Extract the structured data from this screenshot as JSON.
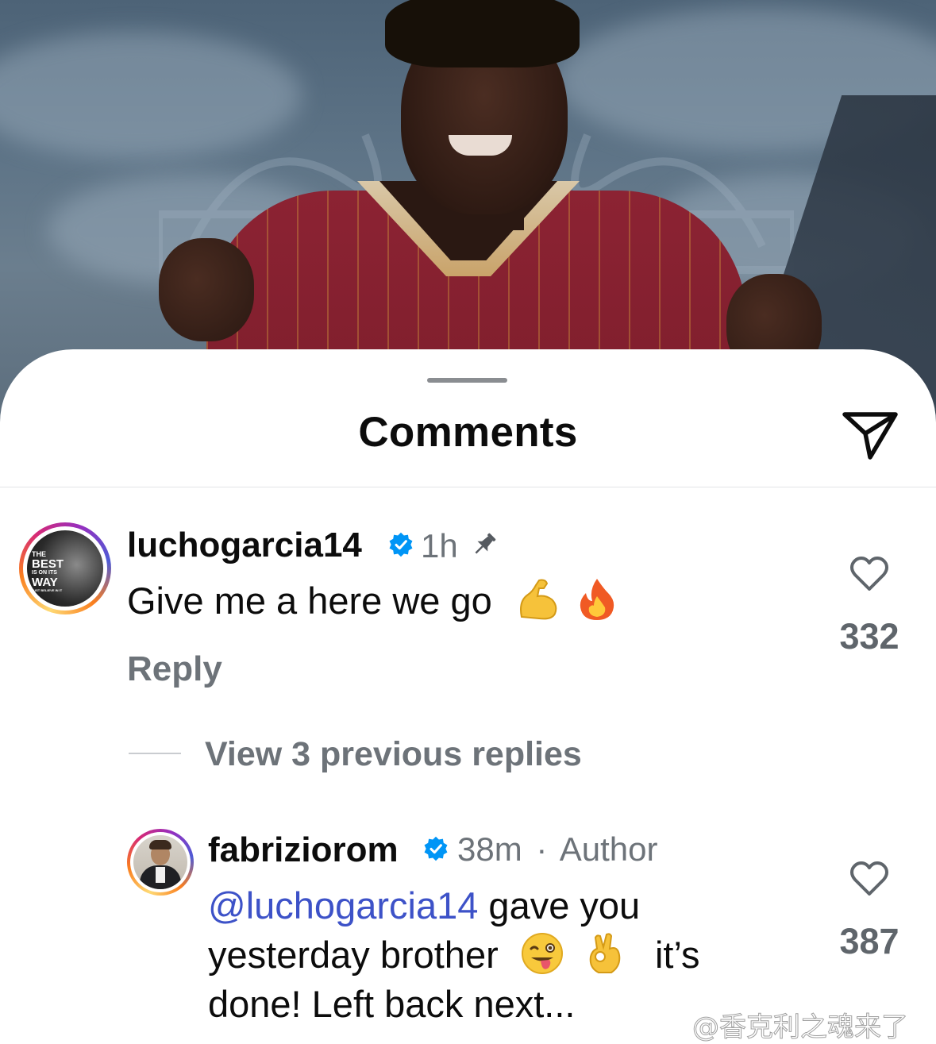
{
  "sheet": {
    "title": "Comments"
  },
  "comments": [
    {
      "username": "luchogarcia14",
      "time": "1h",
      "text": "Give me a here we go",
      "emojis": [
        "flexed-biceps-emoji",
        "fire-emoji"
      ],
      "reply_label": "Reply",
      "like_count": "332",
      "avatar_text": [
        "THE",
        "BEST",
        "IS ON ITS",
        "WAY",
        "JUST BELIEVE IN IT"
      ]
    }
  ],
  "thread": {
    "view_replies_label": "View 3 previous replies"
  },
  "replies": [
    {
      "username": "fabriziorom",
      "time": "38m",
      "separator": "·",
      "author_label": "Author",
      "mention": "@luchogarcia14",
      "line1_rest": " gave you",
      "line2": "yesterday brother",
      "line2_tail": "it’s",
      "line3": "done! Left back next...",
      "emojis": [
        "winking-face-tongue-emoji",
        "ok-hand-emoji"
      ],
      "like_count": "387"
    }
  ],
  "watermark": "@香克利之魂来了",
  "colors": {
    "mention": "#3d52c8",
    "verified": "#0095f6",
    "muted": "#6d7379"
  }
}
